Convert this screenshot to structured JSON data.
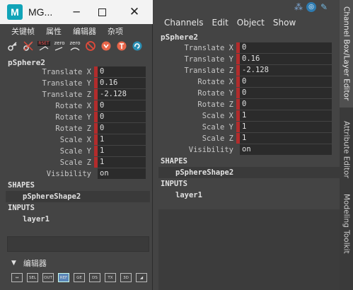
{
  "main": {
    "menu": [
      "Channels",
      "Edit",
      "Object",
      "Show"
    ],
    "object_name": "pSphere2",
    "attributes": [
      {
        "label": "Translate X",
        "value": "0"
      },
      {
        "label": "Translate Y",
        "value": "0.16"
      },
      {
        "label": "Translate Z",
        "value": "-2.128"
      },
      {
        "label": "Rotate X",
        "value": "0"
      },
      {
        "label": "Rotate Y",
        "value": "0"
      },
      {
        "label": "Rotate Z",
        "value": "0"
      },
      {
        "label": "Scale X",
        "value": "1"
      },
      {
        "label": "Scale Y",
        "value": "1"
      },
      {
        "label": "Scale Z",
        "value": "1"
      },
      {
        "label": "Visibility",
        "value": "on"
      }
    ],
    "shapes_header": "SHAPES",
    "shape_item": "pSphereShape2",
    "inputs_header": "INPUTS",
    "input_item": "layer1"
  },
  "right_tabs": [
    "Channel Box/Layer Editor",
    "Attribute Editor",
    "Modeling Toolkit"
  ],
  "float": {
    "app_logo_letter": "M",
    "window_title": "MG...",
    "menu": [
      "关键帧",
      "属性",
      "编辑器",
      "杂项"
    ],
    "toolbar": {
      "reset_label": "RSET",
      "zero_label_1": "zero",
      "zero_label_2": "zero"
    },
    "object_name": "pSphere2",
    "attributes": [
      {
        "label": "Translate X",
        "value": "0"
      },
      {
        "label": "Translate Y",
        "value": "0.16"
      },
      {
        "label": "Translate Z",
        "value": "-2.128"
      },
      {
        "label": "Rotate X",
        "value": "0"
      },
      {
        "label": "Rotate Y",
        "value": "0"
      },
      {
        "label": "Rotate Z",
        "value": "0"
      },
      {
        "label": "Scale X",
        "value": "1"
      },
      {
        "label": "Scale Y",
        "value": "1"
      },
      {
        "label": "Scale Z",
        "value": "1"
      },
      {
        "label": "Visibility",
        "value": "on"
      }
    ],
    "shapes_header": "SHAPES",
    "shape_item": "pSphereShape2",
    "inputs_header": "INPUTS",
    "input_item": "layer1",
    "footer_label": "编辑器",
    "footer_buttons": [
      "↔",
      "SEL",
      "OUT",
      "REF",
      "GE",
      "DS",
      "TX",
      "3D",
      "◢"
    ]
  },
  "colors": {
    "accent_red": "#b22c2c",
    "logo_teal": "#11a4b8",
    "selected_blue": "#5a86b8"
  }
}
